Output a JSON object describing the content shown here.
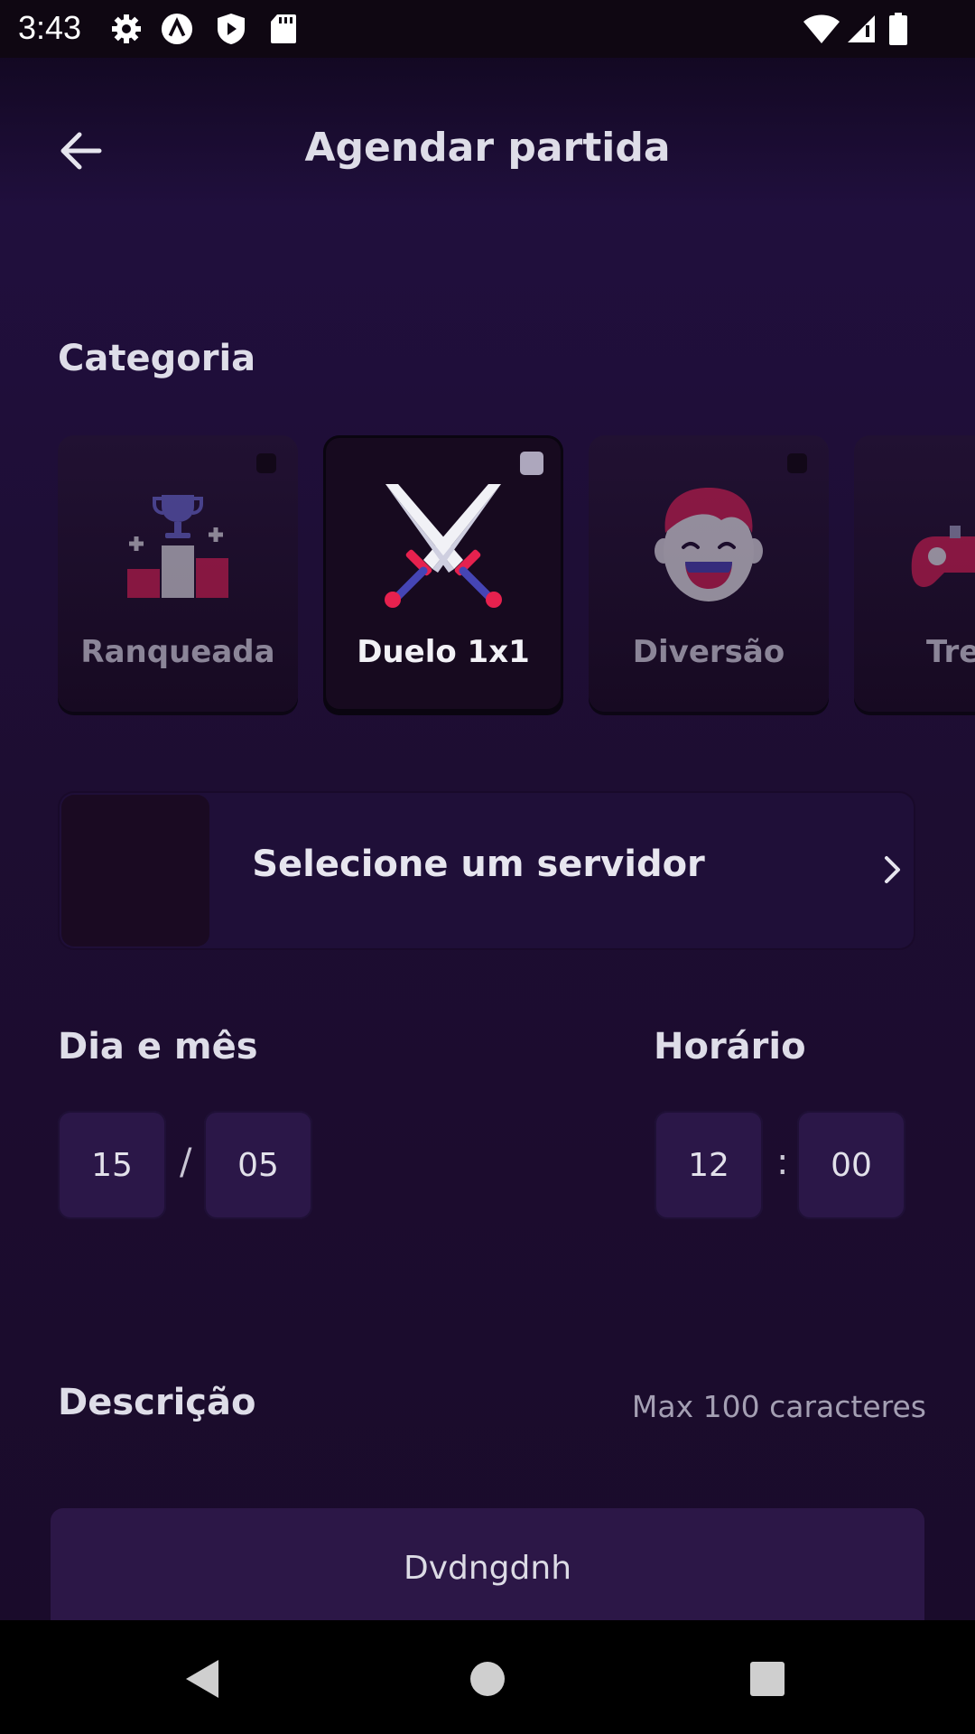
{
  "status_bar": {
    "time": "3:43",
    "icons": [
      "gear-icon",
      "a-circle-icon",
      "shield-play-icon",
      "sd-card-icon",
      "wifi-icon",
      "signal-icon",
      "battery-icon"
    ]
  },
  "header": {
    "back_icon": "arrow-left-icon",
    "title": "Agendar partida"
  },
  "category": {
    "label": "Categoria",
    "items": [
      {
        "label": "Ranqueada",
        "icon": "podium-trophy-icon",
        "selected": false
      },
      {
        "label": "Duelo 1x1",
        "icon": "crossed-swords-icon",
        "selected": true
      },
      {
        "label": "Diversão",
        "icon": "laughing-face-icon",
        "selected": false
      },
      {
        "label": "Tre",
        "icon": "gamepad-icon",
        "selected": false
      }
    ]
  },
  "server": {
    "label": "Selecione um servidor",
    "icon": "chevron-right-icon"
  },
  "date": {
    "label": "Dia e mês",
    "day": "15",
    "separator": "/",
    "month": "05"
  },
  "time": {
    "label": "Horário",
    "hour": "12",
    "separator": ":",
    "minute": "00"
  },
  "description": {
    "label": "Descrição",
    "limit": "Max 100 caracteres",
    "value": "Dvdngdnh"
  },
  "nav": {
    "icons": [
      "back-triangle-icon",
      "home-circle-icon",
      "recents-square-icon"
    ]
  },
  "colors": {
    "background": "#1d0d31",
    "card": "#211132",
    "input": "#2b1748",
    "accent_red": "#c21d4a",
    "accent_blue": "#3f3fa8"
  }
}
